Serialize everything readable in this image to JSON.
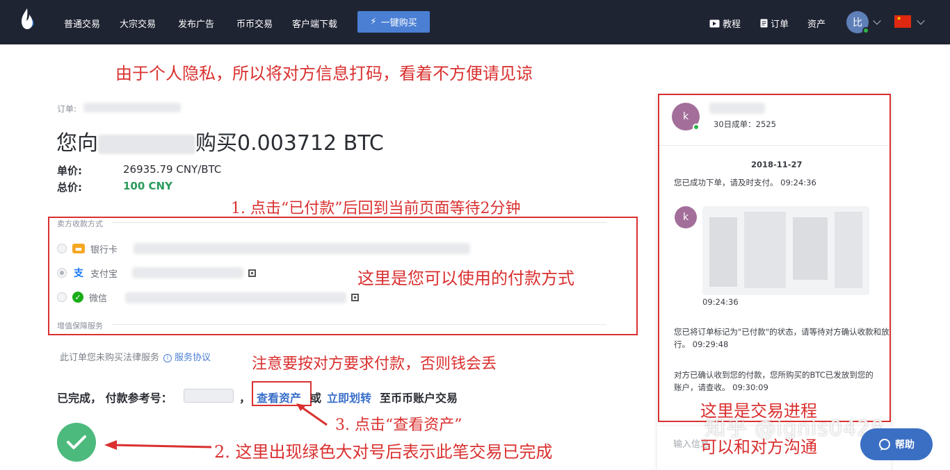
{
  "nav": {
    "items": [
      "普通交易",
      "大宗交易",
      "发布广告",
      "币币交易",
      "客户端下载"
    ],
    "quick_buy": "一键购买",
    "tutorial": "教程",
    "orders": "订单",
    "assets": "资产",
    "avatar_text": "比"
  },
  "order": {
    "label": "订单:",
    "title_prefix": "您向",
    "title_suffix": "购买0.003712 BTC",
    "price_label": "单价:",
    "price_value": "26935.79 CNY/BTC",
    "total_label": "总价:",
    "total_value": "100 CNY"
  },
  "payment": {
    "section_label": "卖方收款方式",
    "methods": [
      "银行卡",
      "支付宝",
      "微信"
    ],
    "value_added_label": "增值保障服务"
  },
  "legal": {
    "text": "此订单您未购买法律服务",
    "link": "服务协议"
  },
  "completion": {
    "status": "已完成，",
    "ref_label": "付款参考号：",
    "separator": "，",
    "view_assets": "查看资产",
    "or": "或",
    "transfer_now": "立即划转",
    "suffix": "至币币账户交易"
  },
  "chat": {
    "avatar_letter": "k",
    "deals_30d": "30日成单：2525",
    "date": "2018-11-27",
    "messages": [
      {
        "text": "您已成功下单，请及时支付。",
        "time": "09:24:36"
      },
      {
        "text": "",
        "time": "09:24:36"
      },
      {
        "text": "您已将订单标记为\"已付款\"的状态，请等待对方确认收款和放行。",
        "time": "09:29:48"
      },
      {
        "text": "对方已确认收到您的付款，您所购买的BTC已发放到您的账户，请查收。",
        "time": "09:30:09"
      }
    ],
    "input_placeholder": "输入信息",
    "help": "帮助"
  },
  "annotations": {
    "privacy": "由于个人隐私，所以将对方信息打码，看着不方便请见谅",
    "step1": "1. 点击“已付款”后回到当前页面等待2分钟",
    "methods_note": "这里是您可以使用的付款方式",
    "warning": "注意要按对方要求付款，否则钱会丢",
    "step3": "3. 点击“查看资产”",
    "step2": "2. 这里出现绿色大对号后表示此笔交易已完成",
    "progress_note": "这里是交易进程",
    "chat_note": "可以和对方沟通"
  },
  "watermark": "知乎 @ignis0428",
  "colors": {
    "nav_bg": "#1f2433",
    "accent_blue": "#4a7fd4",
    "success_green": "#4dba7d",
    "annotation_red": "#d9302f"
  }
}
